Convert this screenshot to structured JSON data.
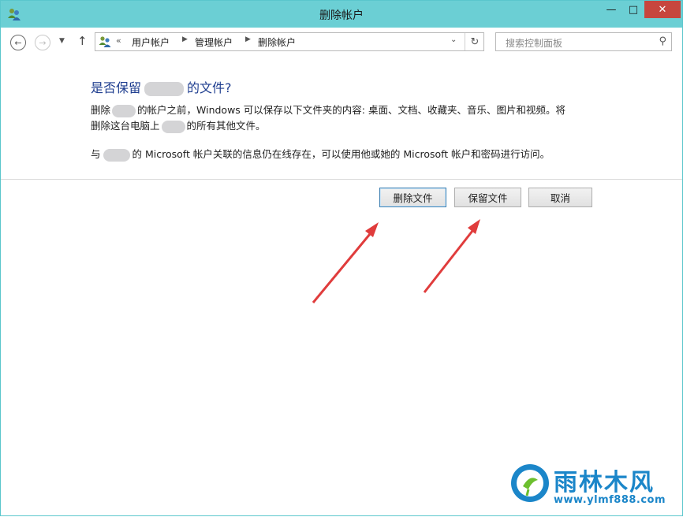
{
  "window": {
    "title": "删除帐户",
    "accent_color": "#6bcfd4",
    "close_color": "#c7463e",
    "controls": {
      "minimize": "minimize-icon",
      "maximize": "maximize-icon",
      "close": "close-icon"
    }
  },
  "nav": {
    "back_icon": "back-arrow-icon",
    "forward_icon": "forward-arrow-icon",
    "recent_icon": "chevron-down-icon",
    "up_icon": "up-arrow-icon",
    "address": {
      "prefix": "«",
      "crumbs": [
        "用户帐户",
        "管理帐户",
        "删除帐户"
      ]
    },
    "search_placeholder": "搜索控制面板"
  },
  "content": {
    "heading_pre": "是否保留",
    "heading_post": "的文件?",
    "para1_a": "删除",
    "para1_b": "的帐户之前，Windows 可以保存以下文件夹的内容: 桌面、文档、收藏夹、音乐、图片和视频。将",
    "para2_a": "删除这台电脑上",
    "para2_b": "的所有其他文件。",
    "para3_a": "与",
    "para3_b": "的 Microsoft 帐户关联的信息仍在线存在，可以使用他或她的 Microsoft 帐户和密码进行访问。"
  },
  "buttons": {
    "delete_files": "删除文件",
    "keep_files": "保留文件",
    "cancel": "取消"
  },
  "annotation_color": "#e03c3c",
  "watermark": {
    "name": "雨林木风",
    "url": "www.ylmf888.com",
    "color": "#1b86c9"
  }
}
